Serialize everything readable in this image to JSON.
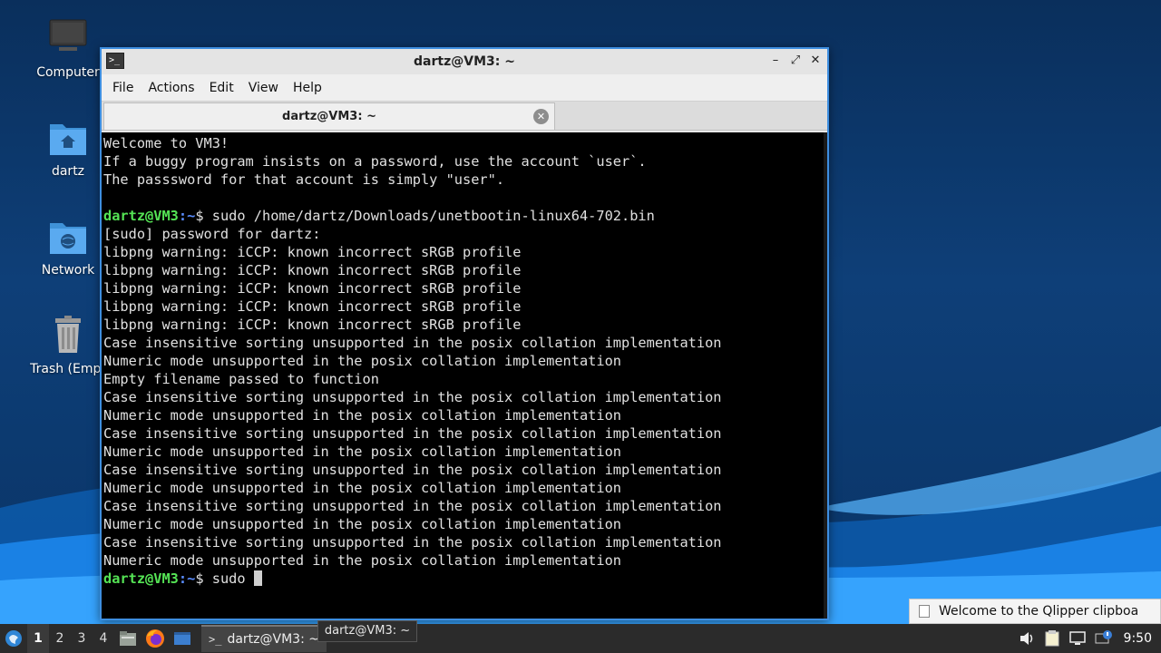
{
  "desktop": {
    "icons": [
      {
        "label": "Computer"
      },
      {
        "label": "dartz"
      },
      {
        "label": "Network"
      },
      {
        "label": "Trash (Empt"
      }
    ]
  },
  "window": {
    "title": "dartz@VM3: ~",
    "controls": {
      "minimize": "–",
      "maximize": "⤢",
      "close": "✕"
    },
    "menu": [
      "File",
      "Actions",
      "Edit",
      "View",
      "Help"
    ],
    "tab": {
      "label": "dartz@VM3: ~"
    }
  },
  "terminal": {
    "lines": [
      {
        "text": "Welcome to VM3!"
      },
      {
        "text": "If a buggy program insists on a password, use the account `user`."
      },
      {
        "text": "The passsword for that account is simply \"user\"."
      },
      {
        "text": ""
      },
      {
        "user": "dartz@VM3",
        "path": ":~",
        "cmd": "$ sudo /home/dartz/Downloads/unetbootin-linux64-702.bin"
      },
      {
        "text": "[sudo] password for dartz:"
      },
      {
        "text": "libpng warning: iCCP: known incorrect sRGB profile"
      },
      {
        "text": "libpng warning: iCCP: known incorrect sRGB profile"
      },
      {
        "text": "libpng warning: iCCP: known incorrect sRGB profile"
      },
      {
        "text": "libpng warning: iCCP: known incorrect sRGB profile"
      },
      {
        "text": "libpng warning: iCCP: known incorrect sRGB profile"
      },
      {
        "text": "Case insensitive sorting unsupported in the posix collation implementation"
      },
      {
        "text": "Numeric mode unsupported in the posix collation implementation"
      },
      {
        "text": "Empty filename passed to function"
      },
      {
        "text": "Case insensitive sorting unsupported in the posix collation implementation"
      },
      {
        "text": "Numeric mode unsupported in the posix collation implementation"
      },
      {
        "text": "Case insensitive sorting unsupported in the posix collation implementation"
      },
      {
        "text": "Numeric mode unsupported in the posix collation implementation"
      },
      {
        "text": "Case insensitive sorting unsupported in the posix collation implementation"
      },
      {
        "text": "Numeric mode unsupported in the posix collation implementation"
      },
      {
        "text": "Case insensitive sorting unsupported in the posix collation implementation"
      },
      {
        "text": "Numeric mode unsupported in the posix collation implementation"
      },
      {
        "text": "Case insensitive sorting unsupported in the posix collation implementation"
      },
      {
        "text": "Numeric mode unsupported in the posix collation implementation"
      },
      {
        "user": "dartz@VM3",
        "path": ":~",
        "cmd": "$ sudo ",
        "cursor": true
      }
    ]
  },
  "notification": {
    "text": "Welcome to the Qlipper clipboa"
  },
  "tooltip": {
    "text": "dartz@VM3: ~"
  },
  "taskbar": {
    "workspaces": [
      "1",
      "2",
      "3",
      "4"
    ],
    "active_workspace": "1",
    "task": {
      "label": "dartz@VM3: ~"
    },
    "clock": "9:50"
  },
  "colors": {
    "prompt_user": "#55e455",
    "prompt_path": "#5a8dff",
    "window_border": "#3d8ee0",
    "taskbar": "#2b2b2b"
  }
}
